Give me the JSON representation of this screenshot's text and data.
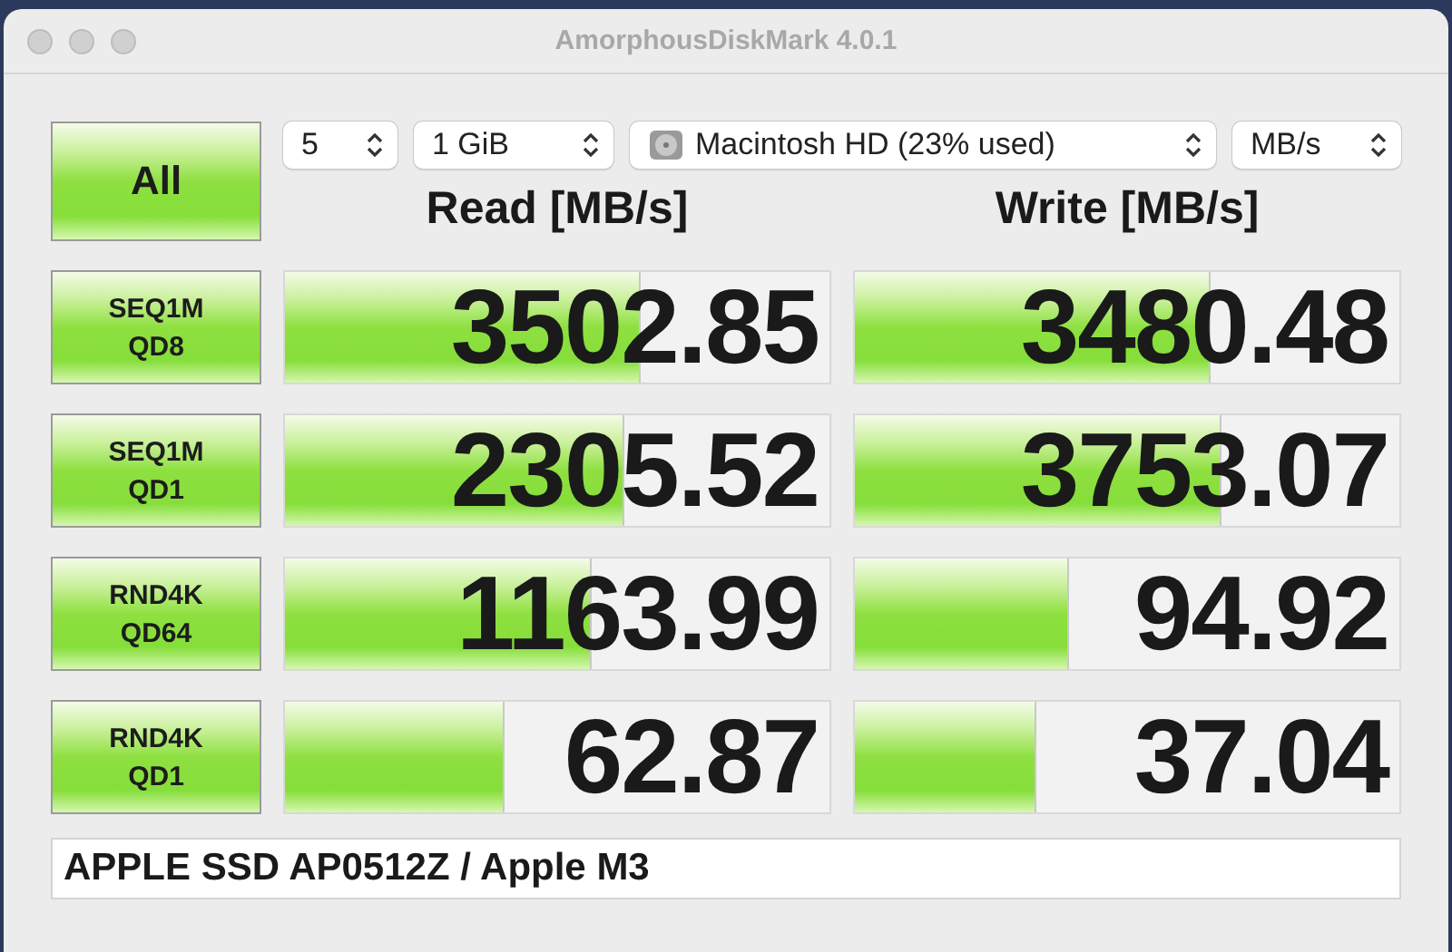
{
  "window": {
    "title": "AmorphousDiskMark 4.0.1"
  },
  "all_button": {
    "label": "All"
  },
  "selectors": [
    {
      "kind": "count",
      "value": "5"
    },
    {
      "kind": "size",
      "value": "1 GiB"
    },
    {
      "kind": "disk",
      "value": "Macintosh HD (23% used)"
    },
    {
      "kind": "unit",
      "value": "MB/s"
    }
  ],
  "columns": [
    "Read [MB/s]",
    "Write [MB/s]"
  ],
  "rows": [
    {
      "test": [
        "SEQ1M",
        "QD8"
      ],
      "read": {
        "value": "3502.85",
        "level": 0.65
      },
      "write": {
        "value": "3480.48",
        "level": 0.65
      }
    },
    {
      "test": [
        "SEQ1M",
        "QD1"
      ],
      "read": {
        "value": "2305.52",
        "level": 0.62
      },
      "write": {
        "value": "3753.07",
        "level": 0.67
      }
    },
    {
      "test": [
        "RND4K",
        "QD64"
      ],
      "read": {
        "value": "1163.99",
        "level": 0.56
      },
      "write": {
        "value": "94.92",
        "level": 0.39
      }
    },
    {
      "test": [
        "RND4K",
        "QD1"
      ],
      "read": {
        "value": "62.87",
        "level": 0.4
      },
      "write": {
        "value": "37.04",
        "level": 0.33
      }
    }
  ],
  "device": {
    "value": "APPLE SSD AP0512Z / Apple M3"
  }
}
